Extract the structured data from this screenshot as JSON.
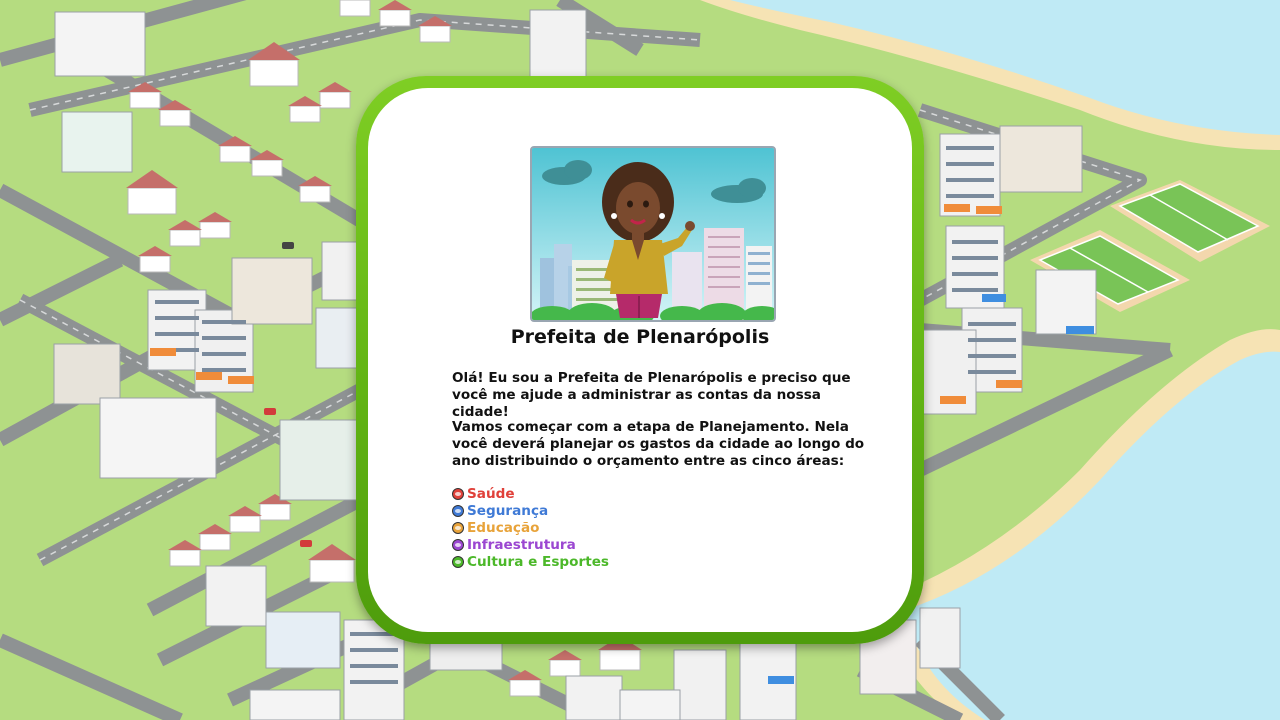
{
  "dialog": {
    "title": "Prefeita de Plenarópolis",
    "paragraph_1": "Olá! Eu sou a Prefeita de Plenarópolis e preciso que você me ajude a administrar as contas da nossa cidade!",
    "paragraph_2": "Vamos começar com a etapa de Planejamento. Nela você deverá planejar os gastos da cidade ao longo do ano distribuindo o orçamento entre as cinco áreas:",
    "areas": [
      {
        "label": "Saúde",
        "color": "#e0413a",
        "icon": "health-icon"
      },
      {
        "label": "Segurança",
        "color": "#3f7ad6",
        "icon": "security-icon"
      },
      {
        "label": "Educação",
        "color": "#e8a33a",
        "icon": "education-icon"
      },
      {
        "label": "Infraestrutura",
        "color": "#9b47d1",
        "icon": "infrastructure-icon"
      },
      {
        "label": "Cultura e Esportes",
        "color": "#4cb82a",
        "icon": "culture-sports-icon"
      }
    ]
  },
  "colors": {
    "grass": "#b5dc80",
    "road": "#8e9293",
    "sea": "#bfeaf5",
    "sand": "#f6e3b4",
    "frame_green": "#62b414"
  }
}
